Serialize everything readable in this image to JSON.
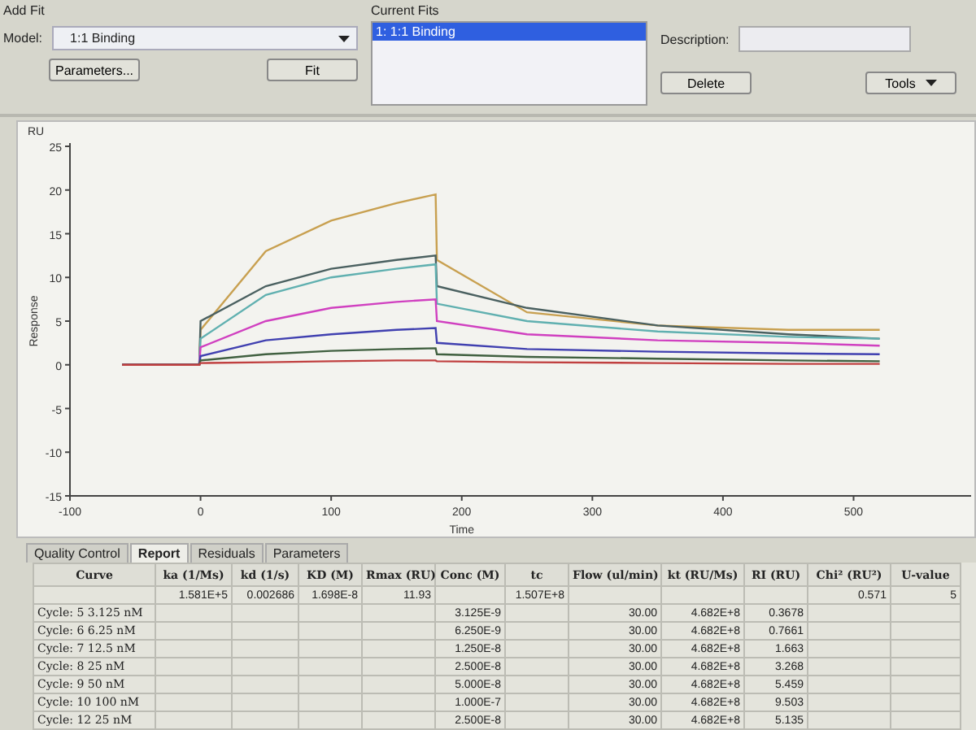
{
  "add_fit": {
    "title": "Add Fit",
    "model_label": "Model:",
    "model_value": "1:1 Binding",
    "buttons": [
      "Parameters...",
      "Fit"
    ]
  },
  "current_fits": {
    "title": "Current Fits",
    "items": [
      {
        "label": "1: 1:1 Binding",
        "selected": true
      }
    ]
  },
  "description": {
    "label": "Description:",
    "buttons": [
      {
        "label": "Delete",
        "kind": "plain"
      },
      {
        "label": "Tools",
        "kind": "menu"
      }
    ]
  },
  "sensorgram": {
    "unit_label": "RU",
    "chart_data": {
      "type": "line",
      "xlabel": "Time",
      "ylabel": "Response",
      "x": [
        -60,
        -1,
        0,
        50,
        100,
        150,
        180,
        181,
        250,
        350,
        450,
        520
      ],
      "series": [
        {
          "color": "#c8a050",
          "values": [
            0,
            0,
            4,
            13,
            16.5,
            18.5,
            19.5,
            12,
            6,
            4.5,
            4,
            4
          ]
        },
        {
          "color": "#4a6060",
          "values": [
            0,
            0,
            5,
            9,
            11,
            12,
            12.5,
            9,
            6.5,
            4.5,
            3.5,
            3
          ]
        },
        {
          "color": "#60b0b0",
          "values": [
            0,
            0,
            3,
            8,
            10,
            11,
            11.5,
            7,
            5,
            3.8,
            3.2,
            3
          ]
        },
        {
          "color": "#d040c0",
          "values": [
            0,
            0,
            2,
            5,
            6.5,
            7.2,
            7.5,
            5,
            3.5,
            2.8,
            2.5,
            2.2
          ]
        },
        {
          "color": "#4040b0",
          "values": [
            0,
            0,
            1,
            2.8,
            3.5,
            4,
            4.2,
            2.5,
            1.8,
            1.5,
            1.3,
            1.2
          ]
        },
        {
          "color": "#406040",
          "values": [
            0,
            0,
            0.5,
            1.2,
            1.6,
            1.8,
            1.9,
            1.2,
            0.9,
            0.7,
            0.5,
            0.4
          ]
        },
        {
          "color": "#c04040",
          "values": [
            0,
            0,
            0.2,
            0.3,
            0.4,
            0.5,
            0.5,
            0.4,
            0.3,
            0.2,
            0.1,
            0.1
          ]
        }
      ],
      "xlim": [
        -100,
        590
      ],
      "ylim": [
        -15,
        25
      ],
      "xticks": [
        -100,
        0,
        100,
        200,
        300,
        400,
        500
      ],
      "yticks": [
        -15,
        -10,
        -5,
        0,
        5,
        10,
        15,
        20,
        25
      ]
    }
  },
  "tabs": [
    {
      "label": "Quality Control",
      "selected": false
    },
    {
      "label": "Report",
      "selected": true
    },
    {
      "label": "Residuals",
      "selected": false
    },
    {
      "label": "Parameters",
      "selected": false
    }
  ],
  "table": {
    "columns": [
      "Curve",
      "ka (1/Ms)",
      "kd (1/s)",
      "KD (M)",
      "Rmax (RU)",
      "Conc (M)",
      "tc",
      "Flow (ul/min)",
      "kt (RU/Ms)",
      "RI (RU)",
      "Chi² (RU²)",
      "U-value"
    ],
    "rows": [
      {
        "cells": [
          "",
          "1.581E+5",
          "0.002686",
          "1.698E-8",
          "11.93",
          "",
          "1.507E+8",
          "",
          "",
          "",
          "0.571",
          "5"
        ]
      },
      {
        "cells": [
          "Cycle: 5  3.125 nM",
          "",
          "",
          "",
          "",
          "3.125E-9",
          "",
          "30.00",
          "4.682E+8",
          "0.3678",
          "",
          ""
        ]
      },
      {
        "cells": [
          "Cycle: 6  6.25 nM",
          "",
          "",
          "",
          "",
          "6.250E-9",
          "",
          "30.00",
          "4.682E+8",
          "0.7661",
          "",
          ""
        ]
      },
      {
        "cells": [
          "Cycle: 7  12.5 nM",
          "",
          "",
          "",
          "",
          "1.250E-8",
          "",
          "30.00",
          "4.682E+8",
          "1.663",
          "",
          ""
        ]
      },
      {
        "cells": [
          "Cycle: 8  25 nM",
          "",
          "",
          "",
          "",
          "2.500E-8",
          "",
          "30.00",
          "4.682E+8",
          "3.268",
          "",
          ""
        ]
      },
      {
        "cells": [
          "Cycle: 9  50 nM",
          "",
          "",
          "",
          "",
          "5.000E-8",
          "",
          "30.00",
          "4.682E+8",
          "5.459",
          "",
          ""
        ]
      },
      {
        "cells": [
          "Cycle: 10  100 nM",
          "",
          "",
          "",
          "",
          "1.000E-7",
          "",
          "30.00",
          "4.682E+8",
          "9.503",
          "",
          ""
        ]
      },
      {
        "cells": [
          "Cycle: 12  25 nM",
          "",
          "",
          "",
          "",
          "2.500E-8",
          "",
          "30.00",
          "4.682E+8",
          "5.135",
          "",
          ""
        ]
      }
    ]
  }
}
